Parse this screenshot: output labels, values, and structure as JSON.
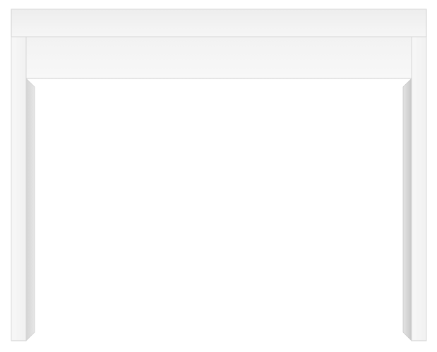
{
  "product": {
    "subject": "console-table",
    "colors": {
      "background": "#ffffff",
      "panel": "#f4f4f4",
      "panel_light": "#f8f8f8",
      "shadow": "#d9d9d9",
      "edge": "#c9c9c9",
      "deep_shadow": "#bdbdbd"
    }
  }
}
